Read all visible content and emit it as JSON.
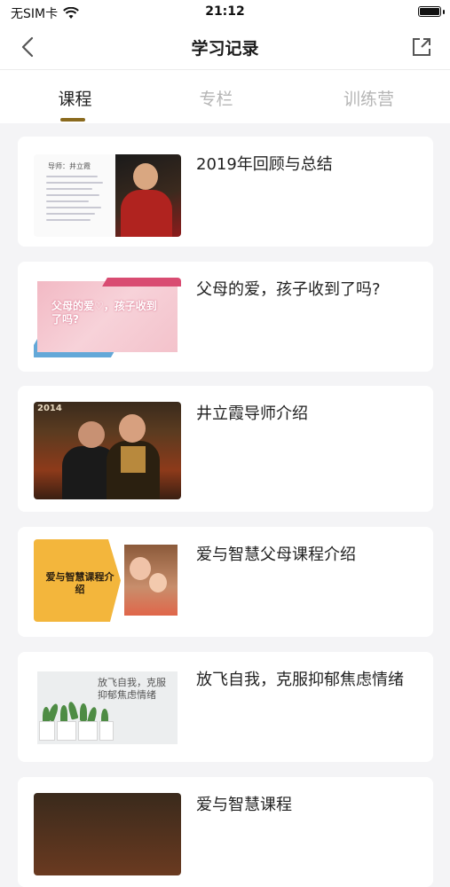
{
  "status": {
    "carrier": "无SIM卡",
    "time": "21:12"
  },
  "nav": {
    "title": "学习记录"
  },
  "tabs": [
    {
      "label": "课程",
      "active": true
    },
    {
      "label": "专栏",
      "active": false
    },
    {
      "label": "训练营",
      "active": false
    }
  ],
  "courses": [
    {
      "title": "2019年回顾与总结",
      "thumb_text": "导师：井立霞"
    },
    {
      "title": "父母的爱，孩子收到了吗?",
      "thumb_text": "父母的爱♡，孩子收到了吗?"
    },
    {
      "title": "井立霞导师介绍",
      "thumb_text": "2014"
    },
    {
      "title": "爱与智慧父母课程介绍",
      "thumb_text": "爱与智慧课程介绍"
    },
    {
      "title": "放飞自我，克服抑郁焦虑情绪",
      "thumb_text": "放飞自我，克服抑郁焦虑情绪"
    },
    {
      "title": "爱与智慧课程"
    }
  ],
  "colors": {
    "accent": "#8a6a1e",
    "background": "#f4f4f6"
  }
}
